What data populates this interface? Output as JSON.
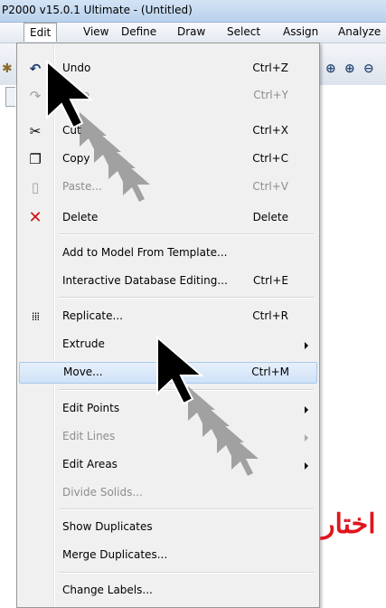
{
  "window": {
    "title": "P2000 v15.0.1 Ultimate  - (Untitled)"
  },
  "menubar": {
    "items": [
      {
        "label": "Edit"
      },
      {
        "label": "View"
      },
      {
        "label": "Define"
      },
      {
        "label": "Draw"
      },
      {
        "label": "Select"
      },
      {
        "label": "Assign"
      },
      {
        "label": "Analyze"
      }
    ]
  },
  "toolbar": {
    "icons": [
      "gear-icon",
      "zoom-in-icon",
      "zoom-in-icon",
      "zoom-out-icon"
    ]
  },
  "edit_menu": {
    "items": [
      {
        "label": "Undo",
        "shortcut": "Ctrl+Z",
        "icon": "undo-icon"
      },
      {
        "label": "Redo",
        "shortcut": "Ctrl+Y",
        "icon": "redo-icon",
        "disabled": true
      },
      {
        "label": "Cut",
        "shortcut": "Ctrl+X",
        "icon": "scissors-icon"
      },
      {
        "label": "Copy",
        "shortcut": "Ctrl+C",
        "icon": "copy-icon"
      },
      {
        "label": "Paste...",
        "shortcut": "Ctrl+V",
        "icon": "paste-icon",
        "disabled": true
      },
      {
        "label": "Delete",
        "shortcut": "Delete",
        "icon": "delete-x-icon"
      },
      {
        "label": "Add to Model From Template...",
        "shortcut": ""
      },
      {
        "label": "Interactive Database Editing...",
        "shortcut": "Ctrl+E"
      },
      {
        "label": "Replicate...",
        "shortcut": "Ctrl+R",
        "icon": "replicate-icon"
      },
      {
        "label": "Extrude",
        "shortcut": "",
        "submenu": true
      },
      {
        "label": "Move...",
        "shortcut": "Ctrl+M",
        "highlighted": true
      },
      {
        "label": "Edit Points",
        "shortcut": "",
        "submenu": true
      },
      {
        "label": "Edit Lines",
        "shortcut": "",
        "submenu": true,
        "disabled": true
      },
      {
        "label": "Edit Areas",
        "shortcut": "",
        "submenu": true
      },
      {
        "label": "Divide Solids...",
        "shortcut": "",
        "disabled": true
      },
      {
        "label": "Show Duplicates",
        "shortcut": ""
      },
      {
        "label": "Merge Duplicates...",
        "shortcut": ""
      },
      {
        "label": "Change Labels...",
        "shortcut": ""
      }
    ]
  },
  "annotation": {
    "text": "اختار",
    "color": "#e0141c"
  }
}
